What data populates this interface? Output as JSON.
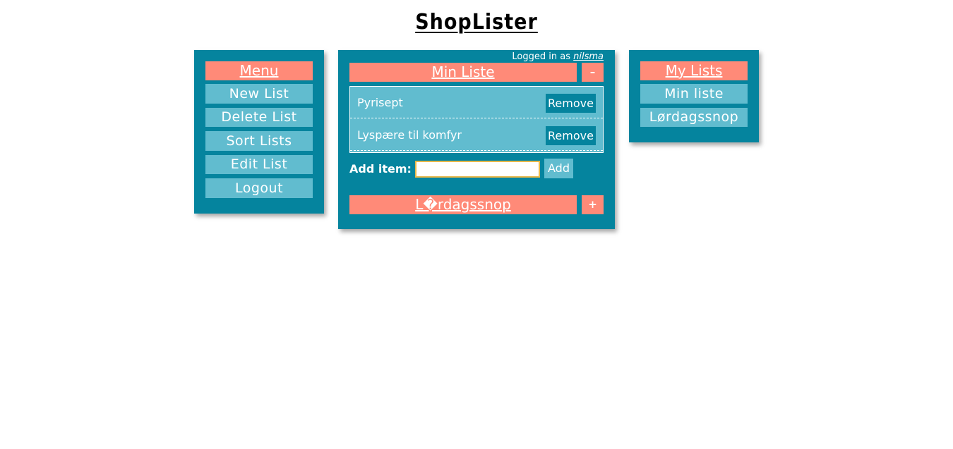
{
  "app": {
    "title": "ShopLister"
  },
  "menu": {
    "header": "Menu",
    "items": [
      "New List",
      "Delete List",
      "Sort Lists",
      "Edit List",
      "Logout"
    ]
  },
  "main": {
    "logged_in_prefix": "Logged in as",
    "username": "nilsma",
    "lists": [
      {
        "title": "Min Liste",
        "toggle": "–",
        "items": [
          {
            "name": "Pyrisept",
            "remove_label": "Remove"
          },
          {
            "name": "Lyspære til komfyr",
            "remove_label": "Remove"
          }
        ]
      },
      {
        "title": "L�rdagssnop",
        "toggle": "+"
      }
    ],
    "add_item_label": "Add item:",
    "add_item_value": "",
    "add_button_label": "Add"
  },
  "my_lists": {
    "header": "My Lists",
    "items": [
      "Min liste",
      "Lørdagssnop"
    ]
  },
  "colors": {
    "panel": "#05849e",
    "button": "#61bccf",
    "header_accent": "#ff8a78",
    "input_border": "#e6b84a"
  }
}
